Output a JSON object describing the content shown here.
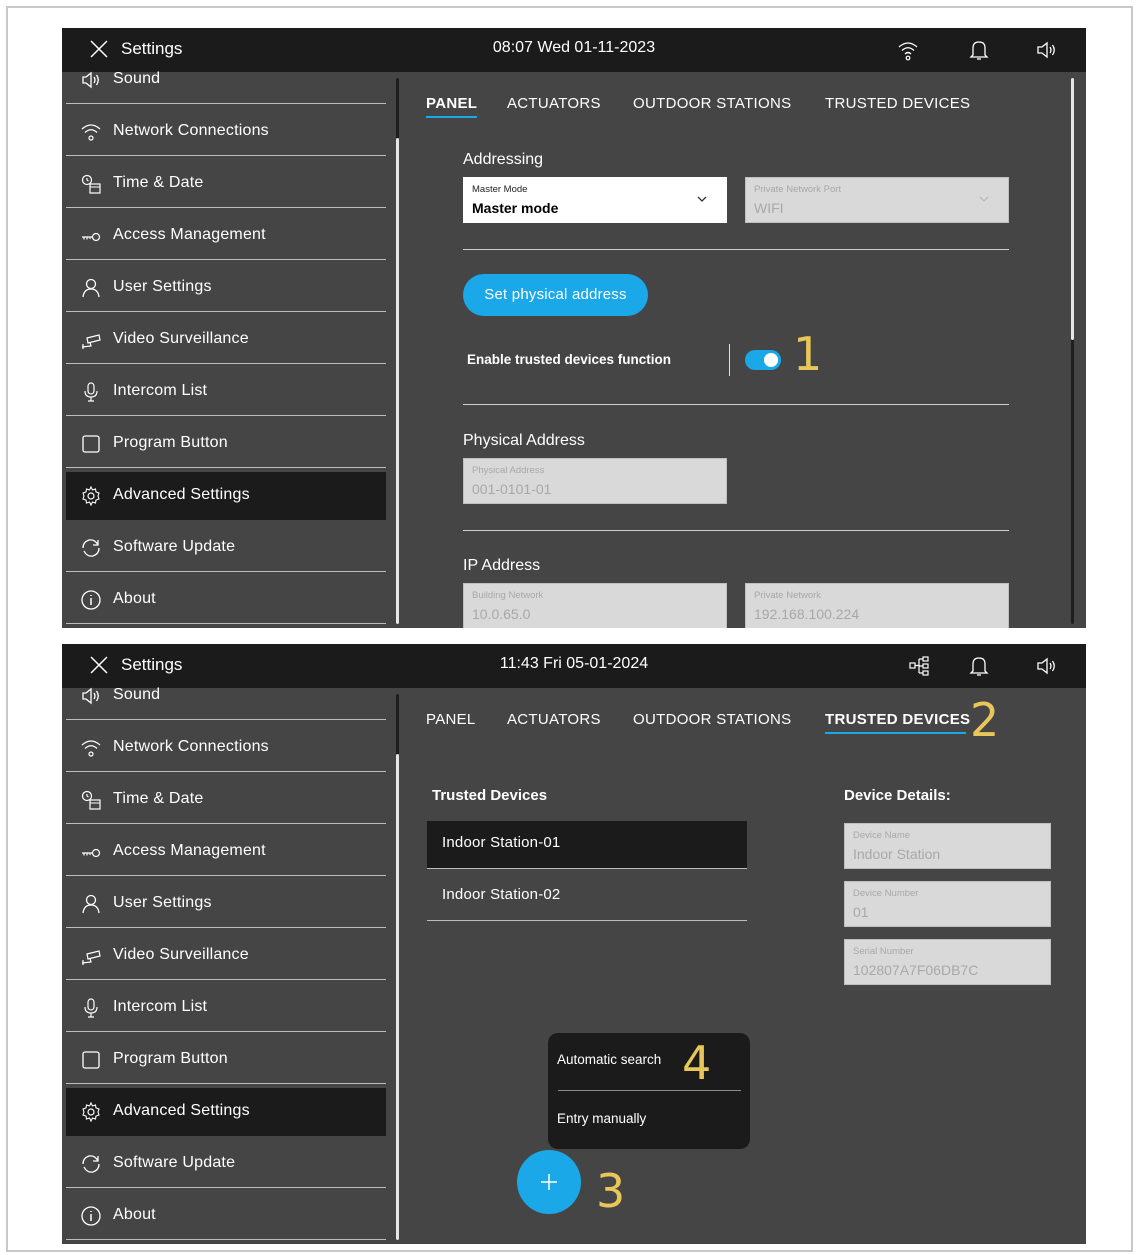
{
  "screens": [
    {
      "topbar": {
        "title": "Settings",
        "clock": "08:07  Wed 01-11-2023",
        "status_icons": [
          "wifi-icon",
          "bell-icon",
          "speaker-icon"
        ]
      },
      "sidebar": {
        "items": [
          {
            "label": "Sound",
            "icon": "speaker-icon"
          },
          {
            "label": "Network Connections",
            "icon": "wifi-icon"
          },
          {
            "label": "Time & Date",
            "icon": "clock-calendar-icon"
          },
          {
            "label": "Access Management",
            "icon": "key-icon"
          },
          {
            "label": "User Settings",
            "icon": "user-icon"
          },
          {
            "label": "Video Surveillance",
            "icon": "camera-icon"
          },
          {
            "label": "Intercom List",
            "icon": "microphone-icon"
          },
          {
            "label": "Program Button",
            "icon": "square-icon"
          },
          {
            "label": "Advanced Settings",
            "icon": "gear-icon",
            "active": true
          },
          {
            "label": "Software Update",
            "icon": "refresh-icon"
          },
          {
            "label": "About",
            "icon": "info-icon"
          }
        ]
      },
      "tabs": [
        {
          "label": "PANEL",
          "active": true
        },
        {
          "label": "ACTUATORS",
          "active": false
        },
        {
          "label": "OUTDOOR STATIONS",
          "active": false
        },
        {
          "label": "TRUSTED DEVICES",
          "active": false
        }
      ],
      "panel": {
        "addressing_title": "Addressing",
        "master_mode": {
          "label": "Master Mode",
          "value": "Master mode"
        },
        "network_port": {
          "label": "Private Network Port",
          "value": "WIFI"
        },
        "set_physical_address_button": "Set physical address",
        "trusted_toggle": {
          "label": "Enable trusted devices function",
          "on": true
        },
        "physical_address_title": "Physical Address",
        "physical_address": {
          "label": "Physical Address",
          "value": "001-0101-01"
        },
        "ip_address_title": "IP Address",
        "building_network": {
          "label": "Building Network",
          "value": "10.0.65.0"
        },
        "private_network": {
          "label": "Private Network",
          "value": "192.168.100.224"
        }
      },
      "callouts": [
        "1"
      ]
    },
    {
      "topbar": {
        "title": "Settings",
        "clock": "11:43  Fri 05-01-2024",
        "status_icons": [
          "network-tree-icon",
          "bell-icon",
          "speaker-icon"
        ]
      },
      "tabs": [
        {
          "label": "PANEL",
          "active": false
        },
        {
          "label": "ACTUATORS",
          "active": false
        },
        {
          "label": "OUTDOOR STATIONS",
          "active": false
        },
        {
          "label": "TRUSTED DEVICES",
          "active": true
        }
      ],
      "trusted": {
        "list_title": "Trusted Devices",
        "devices": [
          "Indoor Station-01",
          "Indoor Station-02"
        ],
        "selected_index": 0,
        "details_title": "Device Details:",
        "device_name": {
          "label": "Device Name",
          "value": "Indoor Station"
        },
        "device_number": {
          "label": "Device Number",
          "value": "01"
        },
        "serial_number": {
          "label": "Serial Number",
          "value": "102807A7F06DB7C"
        },
        "popup": {
          "option1": "Automatic search",
          "option2": "Entry manually"
        },
        "fab_icon": "plus-icon"
      },
      "callouts": [
        "2",
        "3",
        "4"
      ]
    }
  ],
  "colors": {
    "accent": "#1ba8e8",
    "callout": "#e8c65a",
    "panel_bg": "#454545",
    "bar_bg": "#1b1b1b"
  }
}
